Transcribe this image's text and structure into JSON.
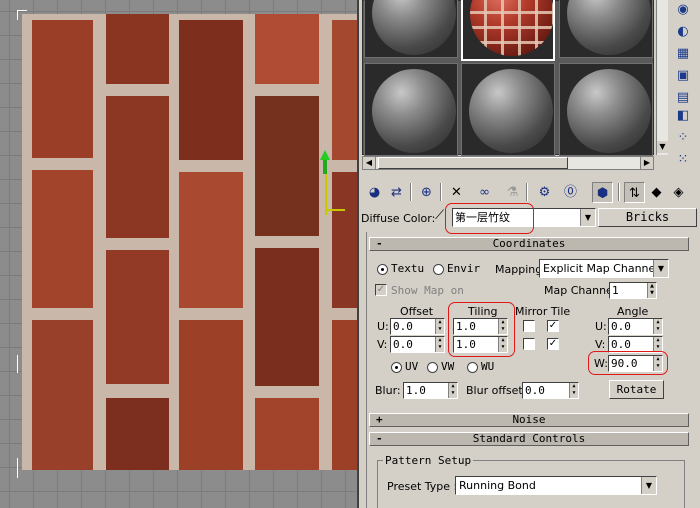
{
  "material_editor": {
    "diffuse_label": "Diffuse Color:",
    "material_name": "第一层竹纹",
    "map_type_button": "Bricks"
  },
  "coordinates": {
    "header": "Coordinates",
    "texture_label": "Textu",
    "environ_label": "Envir",
    "texture_selected": true,
    "mapping_label": "Mapping:",
    "mapping_value": "Explicit Map Channel",
    "show_map_label": "Show Map on",
    "map_channel_label": "Map Channel:",
    "map_channel_value": "1",
    "offset_label": "Offset",
    "tiling_label": "Tiling",
    "mirror_tile_label": "Mirror Tile",
    "angle_label": "Angle",
    "u_label": "U:",
    "v_label": "V:",
    "w_label": "W:",
    "offset_u": "0.0",
    "offset_v": "0.0",
    "tiling_u": "1.0",
    "tiling_v": "1.0",
    "angle_u": "0.0",
    "angle_v": "0.0",
    "angle_w": "90.0",
    "uv_options": [
      "UV",
      "VW",
      "WU"
    ],
    "uv_selected": "UV",
    "blur_label": "Blur:",
    "blur_value": "1.0",
    "blur_offset_label": "Blur offset:",
    "blur_offset_value": "0.0",
    "rotate_button": "Rotate"
  },
  "rollouts": {
    "noise": "Noise",
    "noise_sign": "+",
    "standard_controls": "Standard Controls",
    "standard_sign": "-",
    "coordinates_sign": "-"
  },
  "pattern_setup": {
    "group_label": "Pattern Setup",
    "preset_type_label": "Preset Type :",
    "preset_type_value": "Running Bond"
  },
  "colors": {
    "mortar": "#c9b8aa",
    "brick_dark": "#7a2e1e",
    "brick_mid": "#8f3a26",
    "brick_light": "#b04c34",
    "callout": "#e01818"
  }
}
